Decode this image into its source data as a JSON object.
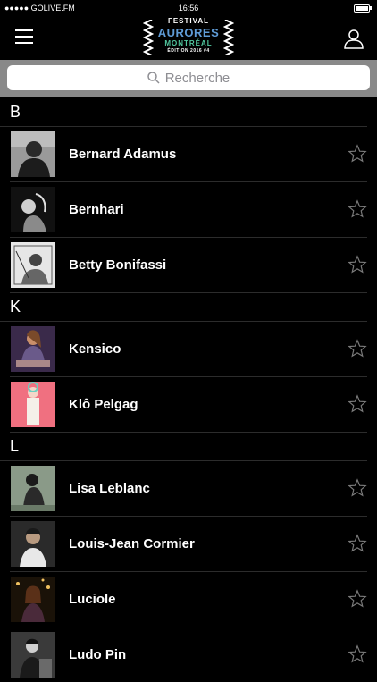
{
  "status_bar": {
    "carrier": "●●●●● GOLIVE.FM",
    "time": "16:56"
  },
  "header": {
    "logo": {
      "line1": "FESTIVAL",
      "line2": "AURORES",
      "line3": "MONTRÉAL",
      "line4": "ÉDITION 2016 #4"
    },
    "menu_icon": "hamburger-icon",
    "user_icon": "user-icon"
  },
  "search": {
    "placeholder": "Recherche",
    "icon": "search-icon"
  },
  "colors": {
    "background": "#000000",
    "search_bar": "#898989",
    "logo_blue": "#5f9bd6",
    "logo_green": "#52c8a0",
    "separator": "#2c2c2c"
  },
  "sections": [
    {
      "letter": "B",
      "artists": [
        {
          "name": "Bernard Adamus"
        },
        {
          "name": "Bernhari"
        },
        {
          "name": "Betty Bonifassi"
        }
      ]
    },
    {
      "letter": "K",
      "artists": [
        {
          "name": "Kensico"
        },
        {
          "name": "Klô Pelgag"
        }
      ]
    },
    {
      "letter": "L",
      "artists": [
        {
          "name": "Lisa Leblanc"
        },
        {
          "name": "Louis-Jean Cormier"
        },
        {
          "name": "Luciole"
        },
        {
          "name": "Ludo Pin"
        }
      ]
    }
  ]
}
